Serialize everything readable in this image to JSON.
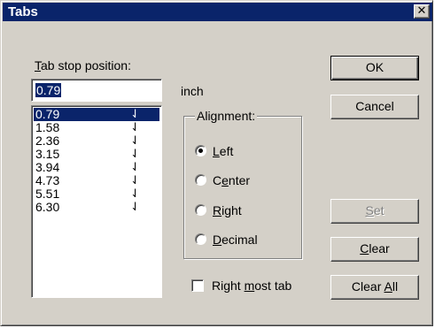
{
  "window": {
    "title": "Tabs",
    "close_glyph": "✕"
  },
  "tab_stop": {
    "label_accel": "T",
    "label_rest": "ab stop position:",
    "value": "0.79",
    "unit": "inch",
    "positions": [
      "0.79",
      "1.58",
      "2.36",
      "3.15",
      "3.94",
      "4.73",
      "5.51",
      "6.30"
    ],
    "selected_index": 0,
    "tab_marker_glyph": "⇃",
    "tab_marker_icon": "decimal-tab-icon"
  },
  "alignment": {
    "label": "Alignment:",
    "options": [
      {
        "accel": "L",
        "rest": "eft",
        "checked": true
      },
      {
        "pre": "C",
        "accel": "e",
        "rest": "nter",
        "checked": false
      },
      {
        "accel": "R",
        "rest": "ight",
        "checked": false
      },
      {
        "accel": "D",
        "rest": "ecimal",
        "checked": false
      }
    ]
  },
  "right_most_tab": {
    "pre": "Right ",
    "accel": "m",
    "rest": "ost tab",
    "checked": false
  },
  "buttons": {
    "ok": "OK",
    "cancel": "Cancel",
    "set_accel": "S",
    "set_rest": "et",
    "clear_accel": "C",
    "clear_rest": "lear",
    "clear_all_pre": "Clear ",
    "clear_all_accel": "A",
    "clear_all_rest": "ll"
  },
  "colors": {
    "face": "#d4d0c8",
    "titlebar": "#0a246a",
    "selection": "#0a246a"
  }
}
